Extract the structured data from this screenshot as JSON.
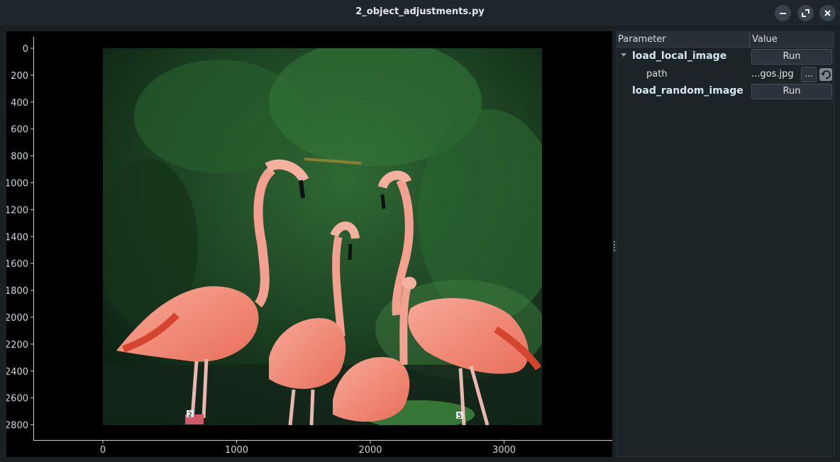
{
  "window": {
    "title": "2_object_adjustments.py",
    "controls": [
      "minimize-icon",
      "maximize-icon",
      "close-icon"
    ]
  },
  "plot": {
    "y_ticks": [
      "0",
      "200",
      "400",
      "600",
      "800",
      "1000",
      "1200",
      "1400",
      "1600",
      "1800",
      "2000",
      "2200",
      "2400",
      "2600",
      "2800"
    ],
    "x_ticks": [
      "0",
      "1000",
      "2000",
      "3000"
    ],
    "image_subject": "flamingos",
    "image_markers": [
      "2",
      "5"
    ]
  },
  "params": {
    "header": {
      "parameter": "Parameter",
      "value": "Value"
    },
    "groups": [
      {
        "name": "load_local_image",
        "action": "Run",
        "expanded": true
      },
      {
        "name": "load_random_image",
        "action": "Run"
      }
    ],
    "path": {
      "name": "path",
      "value": "...gos.jpg",
      "browse": "..."
    }
  },
  "colors": {
    "background": "#1b2024",
    "plot_bg": "#000000",
    "foliage": "#1f4a26",
    "flamingo": "#f08f80"
  }
}
